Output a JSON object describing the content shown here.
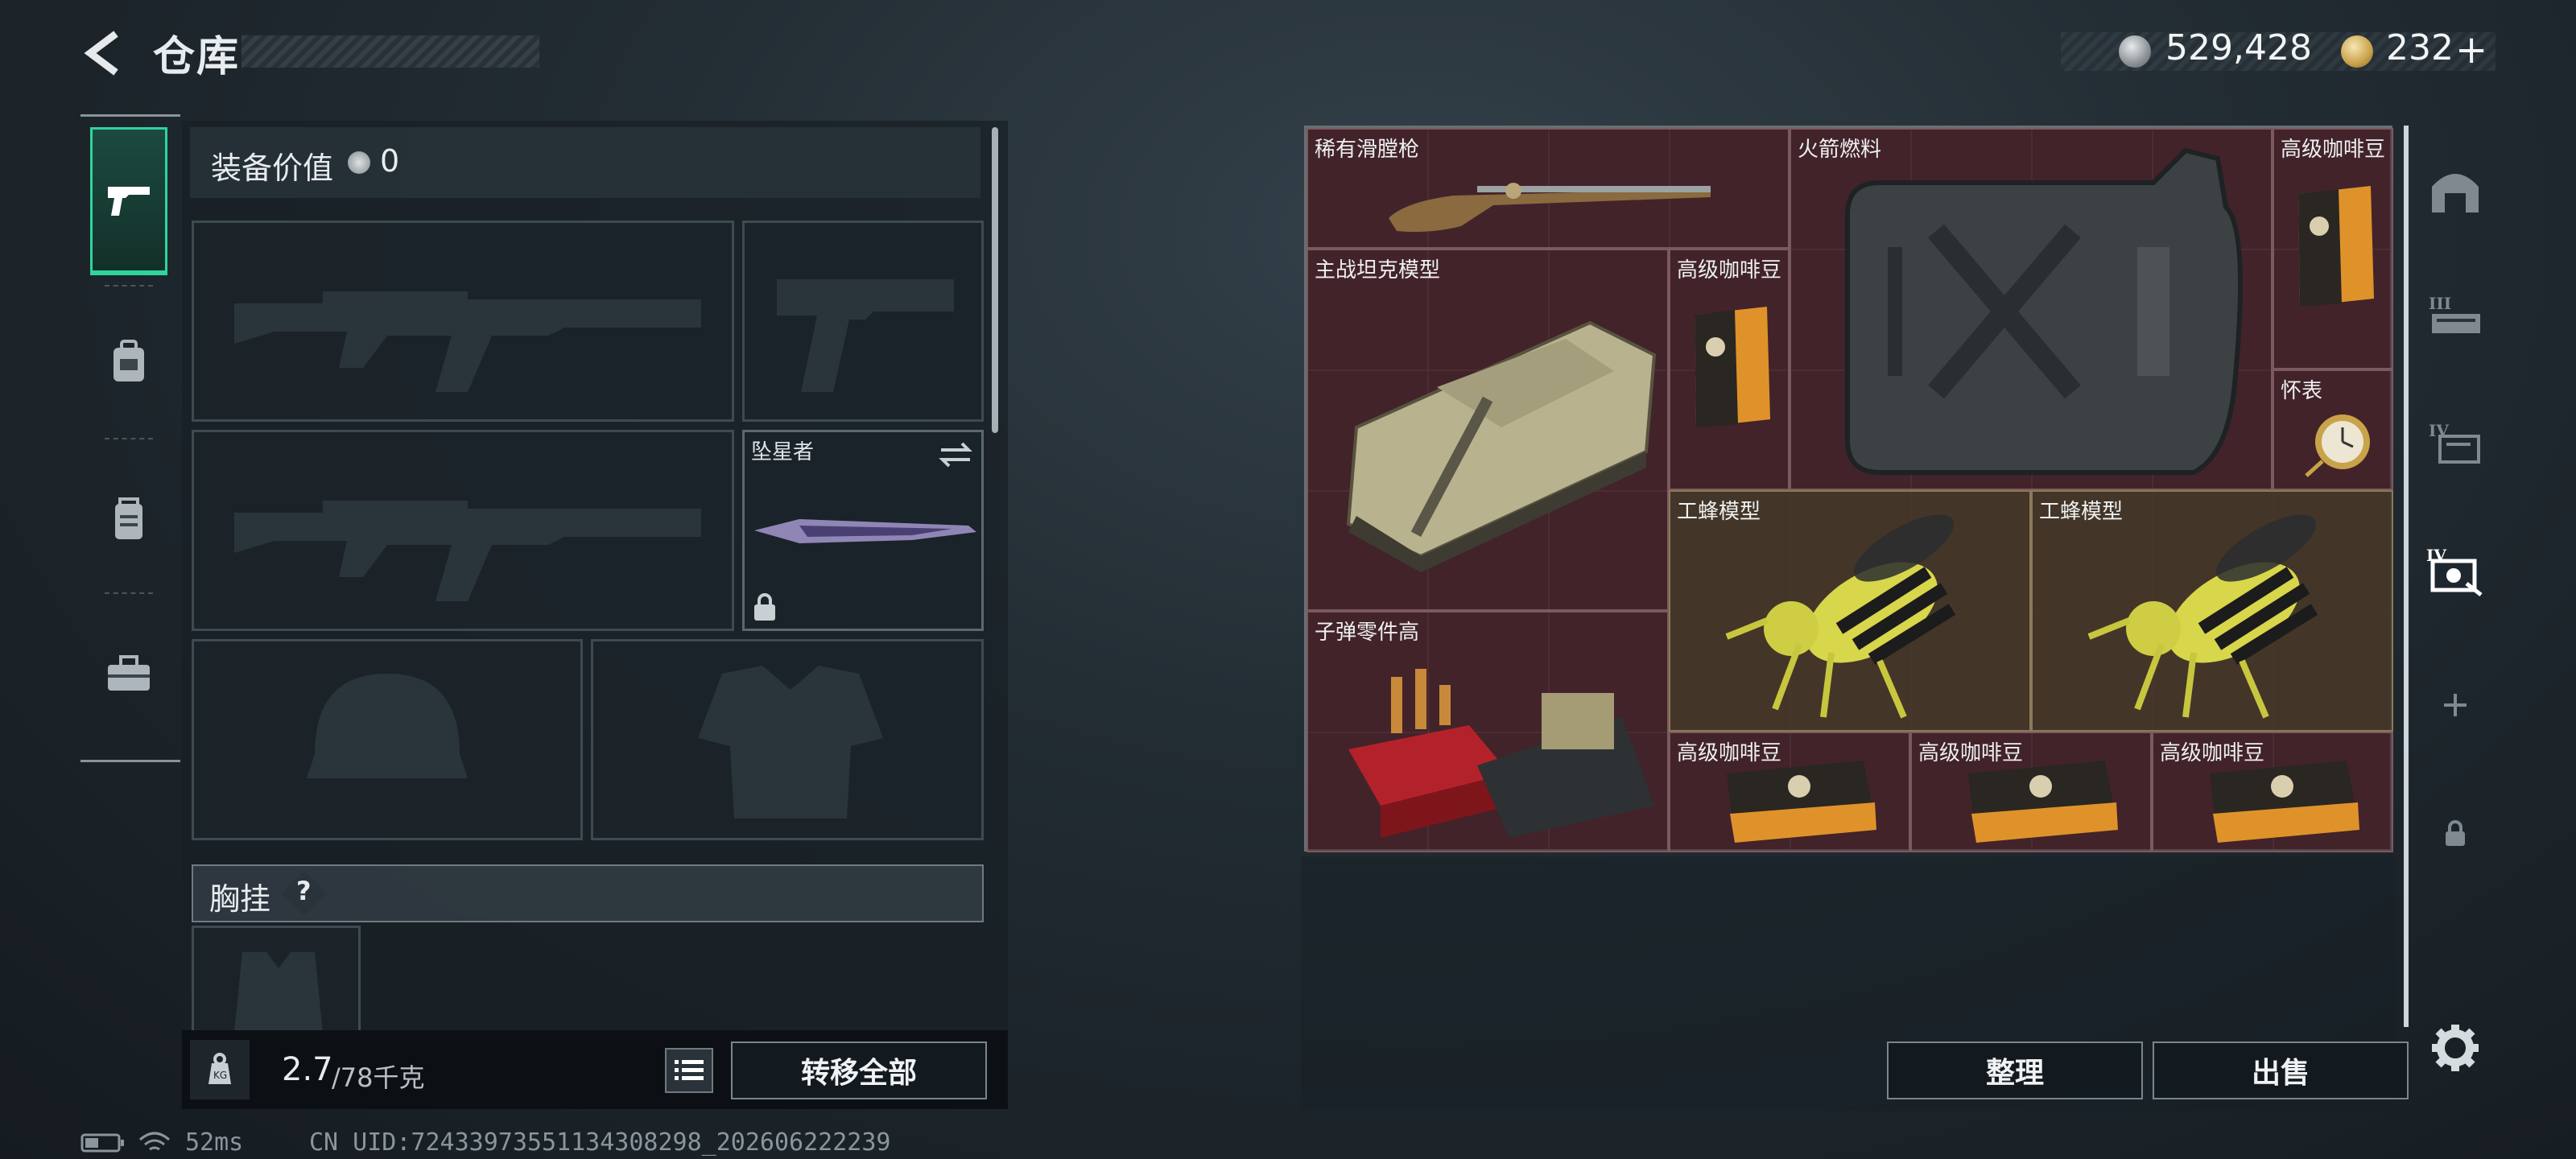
{
  "header": {
    "title": "仓库"
  },
  "currency": {
    "coins": "529,428",
    "tickets": "232",
    "plus": "+"
  },
  "equipment": {
    "value_label": "装备价值",
    "value": "0",
    "slots": {
      "knife_name": "坠星者"
    },
    "chest_rig_label": "胸挂",
    "help": "?"
  },
  "capacity": {
    "current": "2.7",
    "max": "/78千克"
  },
  "buttons": {
    "transfer_all": "转移全部",
    "sort": "整理",
    "sell": "出售"
  },
  "storage_items": [
    {
      "label": "稀有滑膛枪",
      "icon": "musket"
    },
    {
      "label": "火箭燃料",
      "icon": "fuel-canister"
    },
    {
      "label": "高级咖啡豆",
      "icon": "coffee-bag"
    },
    {
      "label": "主战坦克模型",
      "icon": "tank"
    },
    {
      "label": "高级咖啡豆",
      "icon": "coffee-bag"
    },
    {
      "label": "怀表",
      "icon": "pocket-watch"
    },
    {
      "label": "工蜂模型",
      "icon": "bee"
    },
    {
      "label": "工蜂模型",
      "icon": "bee"
    },
    {
      "label": "子弹零件高",
      "icon": "ammo-parts"
    },
    {
      "label": "高级咖啡豆",
      "icon": "coffee-bag"
    },
    {
      "label": "高级咖啡豆",
      "icon": "coffee-bag"
    },
    {
      "label": "高级咖啡豆",
      "icon": "coffee-bag"
    }
  ],
  "status": {
    "ping": "52ms",
    "uid": "CN UID:7243397355113430829​8_202606222239"
  },
  "colors": {
    "accent": "#2fd59b",
    "item_red": "#4a2630",
    "item_gold": "#4a3d2c"
  }
}
